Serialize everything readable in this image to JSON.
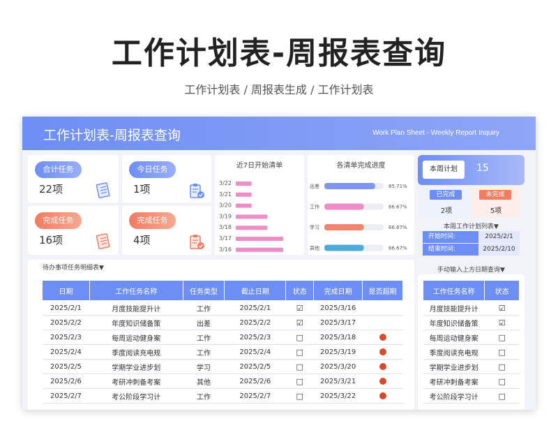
{
  "page": {
    "title": "工作计划表-周报表查询",
    "subtitle": "工作计划表 / 周报表生成 / 工作计划表"
  },
  "banner": {
    "title": "工作计划表-周报表查询",
    "subtitle_en": "Work Plan Sheet - Weekly Report Inquiry"
  },
  "kpis": {
    "total": {
      "label": "合计任务",
      "value": "22项",
      "icon": "document-icon"
    },
    "today": {
      "label": "今日任务",
      "value": "1项",
      "icon": "clipboard-check-icon"
    },
    "done": {
      "label": "完成任务",
      "value": "16项",
      "icon": "document-icon"
    },
    "done2": {
      "label": "完成任务",
      "value": "4项",
      "icon": "clipboard-check-icon"
    }
  },
  "colors": {
    "accent": "#6d8ef4",
    "warn": "#f07c62",
    "overdue": "#d84a2d"
  },
  "chart_data": [
    {
      "type": "bar",
      "orientation": "horizontal",
      "title": "近7日开始清单",
      "categories": [
        "3/22",
        "3/21",
        "3/20",
        "3/19",
        "3/18",
        "3/17",
        "3/16"
      ],
      "values": [
        1,
        1,
        1,
        2,
        2,
        3,
        3
      ]
    },
    {
      "type": "bar",
      "orientation": "horizontal",
      "title": "各清单完成进度",
      "categories": [
        "出差",
        "工作",
        "学习",
        "其他"
      ],
      "values": [
        85.71,
        66.67,
        66.67,
        66.67
      ],
      "labels": [
        "85.71%",
        "66.67%",
        "66.67%",
        "66.67%"
      ],
      "xlim": [
        0,
        100
      ],
      "colors": [
        "#7f95ee",
        "#ee8ec6",
        "#f08570",
        "#52aad9"
      ]
    }
  ],
  "detail": {
    "section_label": "待办事项任务明细表▼",
    "columns": [
      "日期",
      "工作任务名称",
      "任务类型",
      "截止日期",
      "状态",
      "完成日期",
      "是否超期"
    ],
    "rows": [
      {
        "date": "2025/2/1",
        "task": "月度技能提升计",
        "type": "工作",
        "due": "2025/2/1",
        "status": "☑",
        "done": "2025/3/16",
        "overdue": false
      },
      {
        "date": "2025/2/2",
        "task": "年度知识储备策",
        "type": "出差",
        "due": "2025/2/2",
        "status": "☑",
        "done": "2025/3/17",
        "overdue": false
      },
      {
        "date": "2025/2/3",
        "task": "每周运动健身案",
        "type": "工作",
        "due": "2025/2/3",
        "status": "□",
        "done": "2025/3/18",
        "overdue": true
      },
      {
        "date": "2025/2/4",
        "task": "季度阅读充电规",
        "type": "工作",
        "due": "2025/2/4",
        "status": "□",
        "done": "2025/3/19",
        "overdue": true
      },
      {
        "date": "2025/2/5",
        "task": "学期学业进步划",
        "type": "学习",
        "due": "2025/2/5",
        "status": "□",
        "done": "2025/3/20",
        "overdue": true
      },
      {
        "date": "2025/2/6",
        "task": "考研冲刺备考案",
        "type": "其他",
        "due": "2025/2/6",
        "status": "□",
        "done": "2025/3/21",
        "overdue": true
      },
      {
        "date": "2025/2/7",
        "task": "考公阶段学习计",
        "type": "工作",
        "due": "2025/2/7",
        "status": "□",
        "done": "2025/3/22",
        "overdue": true
      }
    ]
  },
  "weekly": {
    "plan_label": "本周计划",
    "plan_value": "15",
    "completed_label": "已完成",
    "completed_value": "2项",
    "pending_label": "未完成",
    "pending_value": "5项",
    "list_label": "本周工作计划列表▼",
    "start_label": "开始时间:",
    "start_value": "2025/2/1",
    "end_label": "结束时间:",
    "end_value": "2025/2/10",
    "hint": "手动输入上方日期查询▼",
    "columns": [
      "工作任务名称",
      "状态"
    ],
    "rows": [
      {
        "task": "月度技能提升计",
        "status": "☑"
      },
      {
        "task": "年度知识储备策",
        "status": "☑"
      },
      {
        "task": "每周运动健身案",
        "status": "□"
      },
      {
        "task": "季度阅读充电规",
        "status": "□"
      },
      {
        "task": "学期学业进步划",
        "status": "□"
      },
      {
        "task": "考研冲刺备考案",
        "status": "□"
      },
      {
        "task": "考公阶段学习计",
        "status": "□"
      }
    ]
  }
}
